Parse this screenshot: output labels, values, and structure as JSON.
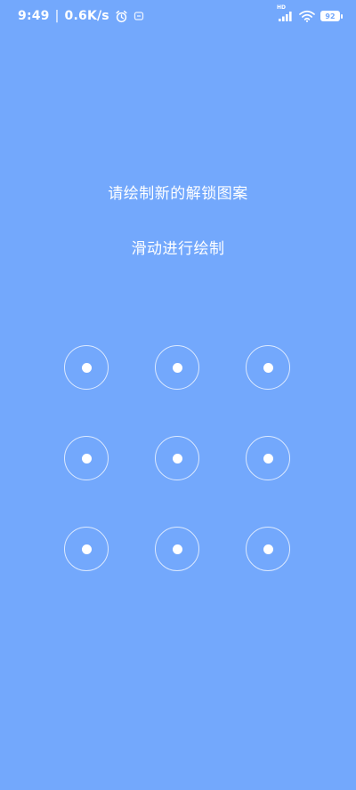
{
  "status_bar": {
    "time": "9:49",
    "separator": "|",
    "net_speed": "0.6K/s",
    "alarm_icon": "alarm-icon",
    "extra_icon": "notification-icon",
    "hd_label": "HD",
    "signal_icon": "signal-icon",
    "wifi_icon": "wifi-icon",
    "battery_level": "92"
  },
  "content": {
    "title": "请绘制新的解锁图案",
    "subtitle": "滑动进行绘制"
  },
  "pattern": {
    "rows": 3,
    "cols": 3,
    "nodes": [
      "1",
      "2",
      "3",
      "4",
      "5",
      "6",
      "7",
      "8",
      "9"
    ]
  },
  "colors": {
    "background": "#73A8FC",
    "foreground": "#FFFFFF"
  }
}
